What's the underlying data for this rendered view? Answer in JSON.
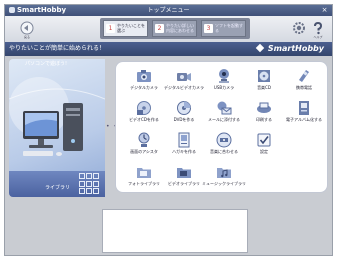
{
  "window": {
    "app_name": "SmartHobby",
    "title": "トップメニュー",
    "close_label": "×"
  },
  "toolbar": {
    "back_label": "戻る",
    "tabs": [
      {
        "num": "1",
        "label": "やりたいことを選ぶ"
      },
      {
        "num": "2",
        "label": "やりたい詳しい内容にあわせる"
      },
      {
        "num": "3",
        "label": "ソフトを起動する"
      }
    ],
    "help_label": "ヘルプ"
  },
  "banner": {
    "message": "やりたいことが簡単に始められる！",
    "brand": "SmartHobby"
  },
  "hero": {
    "title": "パソコンで遊ぼう!",
    "library_label": "ライブラリ"
  },
  "menu": {
    "more": "• • •",
    "items": [
      {
        "label": "デジタルカメラ",
        "icon": "digital-camera-icon"
      },
      {
        "label": "デジタルビデオカメラ",
        "icon": "video-camera-icon"
      },
      {
        "label": "USBカメラ",
        "icon": "usb-camera-icon"
      },
      {
        "label": "音楽CD",
        "icon": "music-cd-icon"
      },
      {
        "label": "携帯電話",
        "icon": "mobile-phone-icon"
      },
      {
        "label": "ビデオCDを作る",
        "icon": "video-cd-icon"
      },
      {
        "label": "DVDを作る",
        "icon": "dvd-icon"
      },
      {
        "label": "メールに添付する",
        "icon": "mail-attach-icon"
      },
      {
        "label": "印刷する",
        "icon": "print-icon"
      },
      {
        "label": "電子アルバム化する",
        "icon": "e-album-icon"
      },
      {
        "label": "画面のアシスタ",
        "icon": "screen-assistant-icon"
      },
      {
        "label": "ハガキを作る",
        "icon": "postcard-icon"
      },
      {
        "label": "音楽に合わせる",
        "icon": "audio-icon"
      },
      {
        "label": "設定",
        "icon": "settings-checkbox-icon"
      },
      {
        "label": "フォトライブラリ",
        "icon": "photo-library-icon"
      },
      {
        "label": "ビデオライブラリ",
        "icon": "video-library-icon"
      },
      {
        "label": "ミュージックライブラリ",
        "icon": "music-library-icon"
      }
    ]
  }
}
